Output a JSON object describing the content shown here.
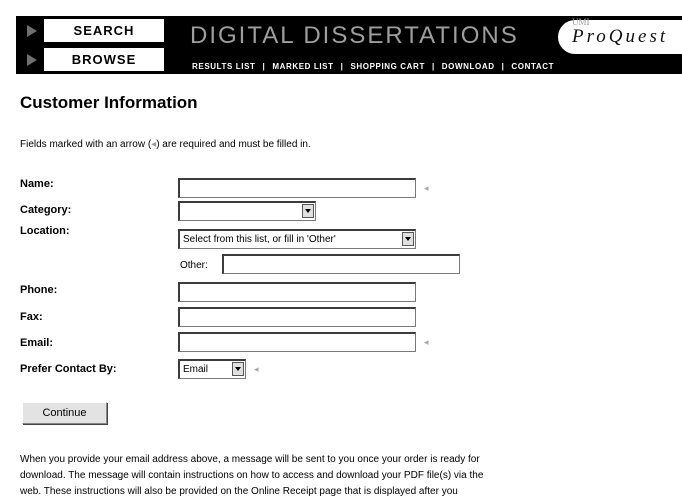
{
  "header": {
    "nav": {
      "search": "SEARCH",
      "browse": "BROWSE"
    },
    "banner_title": "DIGITAL DISSERTATIONS",
    "logo": "ProQuest",
    "logo_mark": "UMI",
    "links": [
      "RESULTS LIST",
      "MARKED LIST",
      "SHOPPING CART",
      "DOWNLOAD",
      "CONTACT"
    ]
  },
  "form": {
    "title": "Customer Information",
    "note_before": "Fields marked with an arrow (",
    "note_arrow": "◂",
    "note_after": ") are required and must be filled in.",
    "required_marker": "◂",
    "labels": {
      "name": "Name:",
      "category": "Category:",
      "location": "Location:",
      "phone": "Phone:",
      "fax": "Fax:",
      "email": "Email:",
      "prefer_contact": "Prefer Contact By:"
    },
    "values": {
      "name": "",
      "category": "",
      "other": "",
      "phone": "",
      "fax": "",
      "email": ""
    },
    "location_selected": "Select from this list, or fill in 'Other'",
    "other_label": "Other:",
    "prefer_contact_selected": "Email",
    "continue_label": "Continue"
  },
  "footer_text": [
    "When you provide your email address above, a message will be sent to you once your order is ready for",
    "download. The message will contain instructions on how to access and download your PDF file(s) via the",
    "web. These instructions will also be provided on the Online Receipt page that is displayed after you"
  ]
}
